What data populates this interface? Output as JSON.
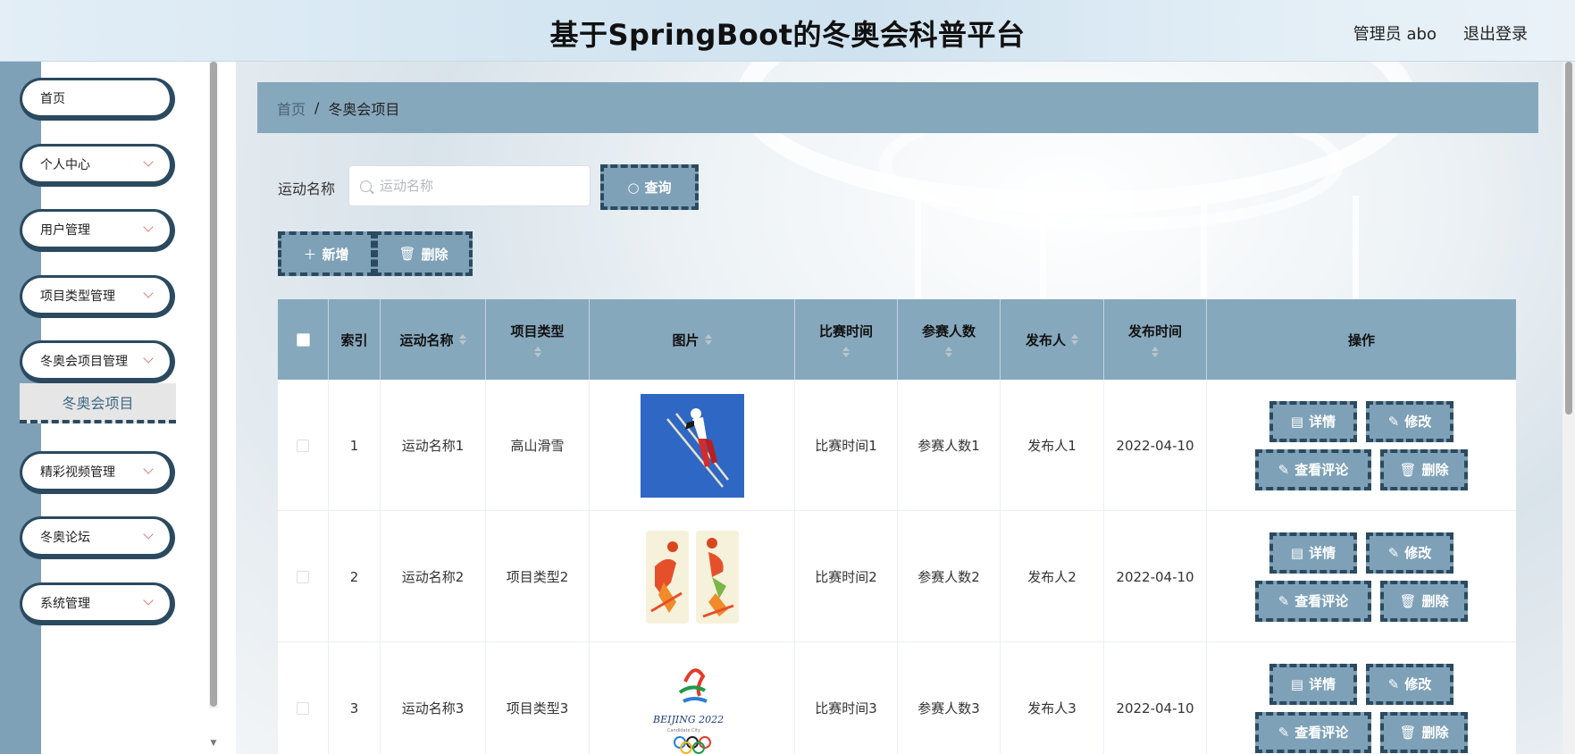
{
  "header": {
    "title": "基于SpringBoot的冬奥会科普平台",
    "user": "管理员 abo",
    "logout": "退出登录"
  },
  "sidebar": {
    "items": [
      {
        "label": "首页"
      },
      {
        "label": "个人中心"
      },
      {
        "label": "用户管理"
      },
      {
        "label": "项目类型管理"
      },
      {
        "label": "冬奥会项目管理"
      },
      {
        "label": "精彩视频管理"
      },
      {
        "label": "冬奥论坛"
      },
      {
        "label": "系统管理"
      }
    ],
    "active_sub": "冬奥会项目"
  },
  "breadcrumb": {
    "home": "首页",
    "separator": "/",
    "current": "冬奥会项目"
  },
  "search": {
    "label": "运动名称",
    "placeholder": "运动名称",
    "value": "",
    "button": "查询"
  },
  "actions": {
    "add": "新增",
    "delete": "删除"
  },
  "table": {
    "columns": [
      "索引",
      "运动名称",
      "项目类型",
      "图片",
      "比赛时间",
      "参赛人数",
      "发布人",
      "发布时间",
      "操作"
    ],
    "rows": [
      {
        "index": "1",
        "name": "运动名称1",
        "type": "高山滑雪",
        "time": "比赛时间1",
        "count": "参赛人数1",
        "publisher": "发布人1",
        "date": "2022-04-10"
      },
      {
        "index": "2",
        "name": "运动名称2",
        "type": "项目类型2",
        "time": "比赛时间2",
        "count": "参赛人数2",
        "publisher": "发布人2",
        "date": "2022-04-10"
      },
      {
        "index": "3",
        "name": "运动名称3",
        "type": "项目类型3",
        "time": "比赛时间3",
        "count": "参赛人数3",
        "publisher": "发布人3",
        "date": "2022-04-10"
      }
    ],
    "row_actions": {
      "detail": "详情",
      "edit": "修改",
      "comments": "查看评论",
      "delete": "删除"
    },
    "logo_text": "BEIJING 2022",
    "logo_subtext": "Candidate City"
  },
  "colors": {
    "accent": "#7ea1b7",
    "header_bar": "#86a8bc",
    "dark_border": "#2b4a60"
  }
}
